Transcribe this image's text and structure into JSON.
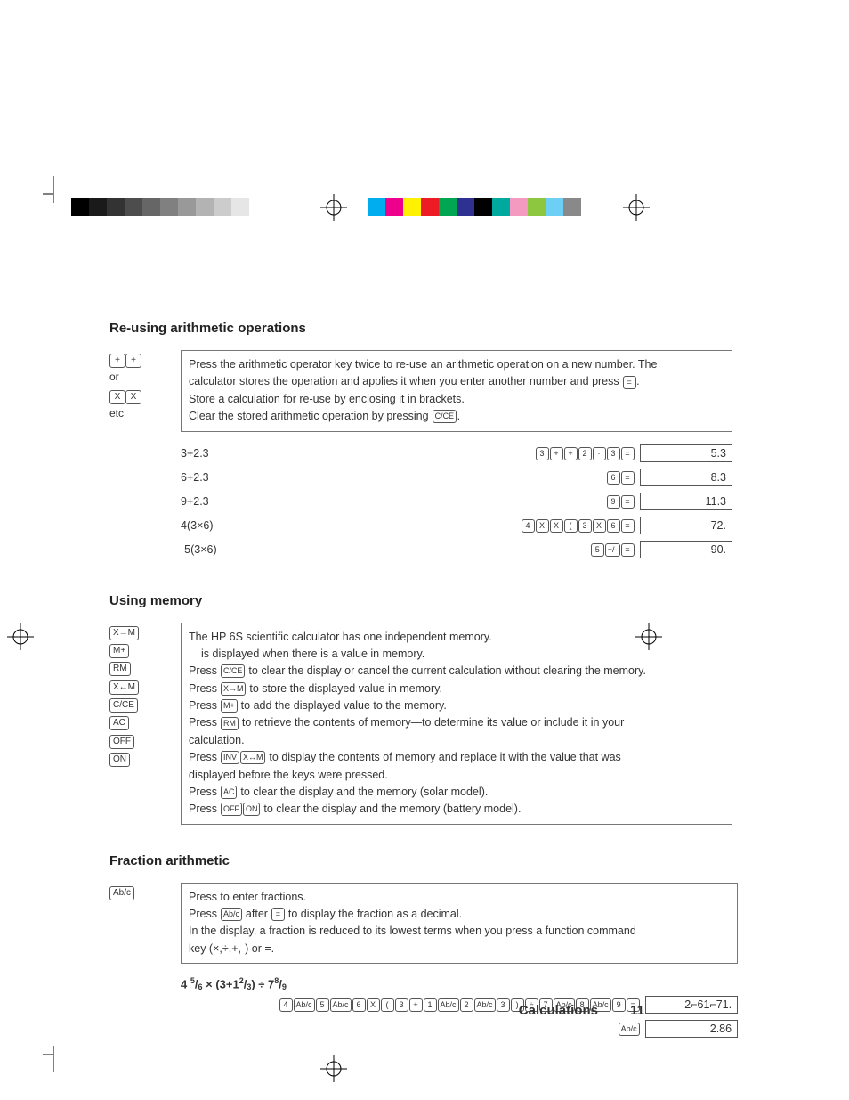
{
  "section1": {
    "heading": "Re-using arithmetic operations",
    "left": {
      "plus": "+",
      "or": "or",
      "x": "X",
      "etc": "etc"
    },
    "info": {
      "line1a": "Press the arithmetic operator key twice to re-use an arithmetic operation on a new number. The",
      "line1b": "calculator stores the operation and applies it when you enter another number and press ",
      "line1c": ".",
      "key_eq": "=",
      "line2": "Store a calculation for re-use by enclosing it in brackets.",
      "line3a": "Clear the stored arithmetic operation by pressing ",
      "line3b": ".",
      "key_cce": "C/CE"
    },
    "rows": [
      {
        "expr": "3+2.3",
        "keys": [
          "3",
          "+",
          "+",
          "2",
          "·",
          "3",
          "="
        ],
        "result": "5.3"
      },
      {
        "expr": "6+2.3",
        "keys": [
          "6",
          "="
        ],
        "result": "8.3"
      },
      {
        "expr": "9+2.3",
        "keys": [
          "9",
          "="
        ],
        "result": "11.3"
      },
      {
        "expr": "4(3×6)",
        "keys": [
          "4",
          "X",
          "X",
          "(",
          "3",
          "X",
          "6",
          "="
        ],
        "result": "72."
      },
      {
        "expr": "-5(3×6)",
        "keys": [
          "5",
          "+/-",
          "="
        ],
        "result": "-90."
      }
    ]
  },
  "section2": {
    "heading": "Using memory",
    "left_keys": [
      "X→M",
      "M+",
      "RM",
      "X↔M",
      "C/CE",
      "AC",
      "OFF",
      "ON"
    ],
    "info": {
      "l1": "The HP 6S scientific calculator has one independent memory.",
      "l2": "is displayed when there is a value in memory.",
      "l3a": "Press ",
      "l3b": " to clear the display or cancel the current calculation without clearing the memory.",
      "k3": "C/CE",
      "l4a": "Press ",
      "l4b": " to store the displayed value in memory.",
      "k4": "X→M",
      "l5a": "Press ",
      "l5b": " to add the displayed value to the memory.",
      "k5": "M+",
      "l6a": "Press ",
      "l6b": " to retrieve the contents of memory—to determine its value or include it in your",
      "k6": "RM",
      "l6c": "calculation.",
      "l7a": "Press ",
      "l7b": " to display the contents of memory and replace it with the value that was",
      "k7a": "INV",
      "k7b": "X↔M",
      "l7c": "displayed before the keys were pressed.",
      "l8a": "Press ",
      "l8b": " to clear the display and the memory (solar model).",
      "k8": "AC",
      "l9a": "Press ",
      "l9b": " to clear the display and the memory (battery model).",
      "k9a": "OFF",
      "k9b": "ON"
    }
  },
  "section3": {
    "heading": "Fraction arithmetic",
    "left_key": "Ab/c",
    "info": {
      "l1": "Press to enter fractions.",
      "l2a": "Press ",
      "l2b": " after ",
      "l2c": " to display the fraction as a decimal.",
      "k2a": "Ab/c",
      "k2b": "=",
      "l3": "In the display, a fraction is reduced to its lowest terms when you press a function command",
      "l4": "key (×,÷,+,-) or =."
    },
    "example": {
      "heading_parts": {
        "p1": "4 ",
        "s1": "5",
        "p2": "/",
        "s2": "6",
        "p3": " × (3+1",
        "s3": "2",
        "p4": "/",
        "s4": "3",
        "p5": ") ÷ 7",
        "s5": "8",
        "p6": "/",
        "s6": "9"
      },
      "row1": {
        "keys": [
          "4",
          "Ab/c",
          "5",
          "Ab/c",
          "6",
          "X",
          "(",
          "3",
          "+",
          "1",
          "Ab/c",
          "2",
          "Ab/c",
          "3",
          ")",
          "÷",
          "7",
          "Ab/c",
          "8",
          "Ab/c",
          "9",
          "="
        ],
        "result": "2⌐61⌐71."
      },
      "row2": {
        "keys": [
          "Ab/c"
        ],
        "result": "2.86"
      }
    }
  },
  "footer": {
    "label": "Calculations",
    "page": "11"
  }
}
